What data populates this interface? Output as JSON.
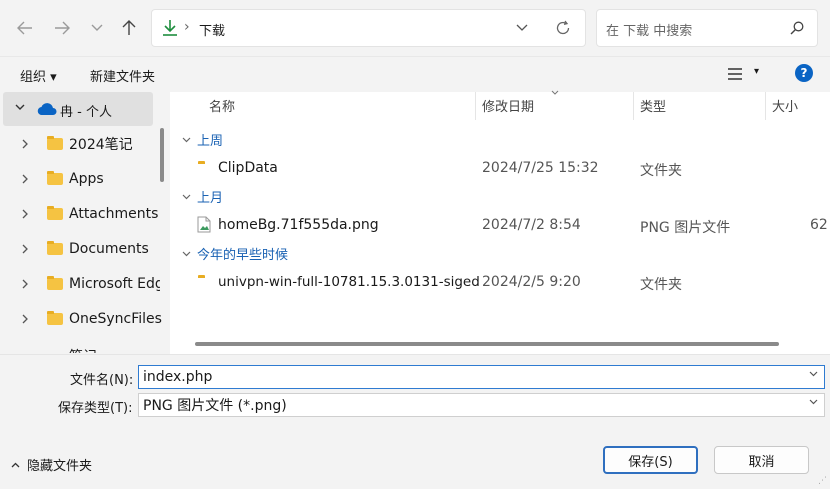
{
  "nav": {
    "back_icon": "arrow-left-icon",
    "forward_icon": "arrow-right-icon",
    "recent_icon": "chevron-down-icon",
    "up_icon": "arrow-up-icon"
  },
  "address": {
    "separator": "›",
    "location": "下载",
    "refresh_icon": "refresh-icon"
  },
  "search": {
    "placeholder": "在 下载 中搜索"
  },
  "toolbar": {
    "organize": "组织 ▾",
    "new_folder": "新建文件夹",
    "view_icon": "list-view-icon",
    "help_icon": "help-icon"
  },
  "sidebar": {
    "onedrive": "冉 - 个人",
    "items": [
      {
        "label": "2024笔记"
      },
      {
        "label": "Apps"
      },
      {
        "label": "Attachments"
      },
      {
        "label": "Documents"
      },
      {
        "label": "Microsoft Edge"
      },
      {
        "label": "OneSyncFiles"
      },
      {
        "label": "笔记"
      }
    ]
  },
  "columns": {
    "name": "名称",
    "date": "修改日期",
    "type": "类型",
    "size": "大小"
  },
  "groups": [
    {
      "label": "上周",
      "files": [
        {
          "name": "ClipData",
          "date": "2024/7/25 15:32",
          "type": "文件夹",
          "size": ""
        }
      ]
    },
    {
      "label": "上月",
      "files": [
        {
          "name": "homeBg.71f555da.png",
          "date": "2024/7/2 8:54",
          "type": "PNG 图片文件",
          "size": "62"
        }
      ]
    },
    {
      "label": "今年的早些时候",
      "files": [
        {
          "name": "univpn-win-full-10781.15.3.0131-siged",
          "date": "2024/2/5 9:20",
          "type": "文件夹",
          "size": ""
        }
      ]
    }
  ],
  "form": {
    "filename_label": "文件名(N):",
    "filename_value": "index.php",
    "filetype_label": "保存类型(T):",
    "filetype_value": "PNG 图片文件 (*.png)"
  },
  "footer": {
    "hide_folders": "隐藏文件夹",
    "save": "保存(S)",
    "cancel": "取消"
  },
  "colors": {
    "accent": "#0a64c4",
    "folder": "#f5c342",
    "download": "#1e8e3e"
  }
}
